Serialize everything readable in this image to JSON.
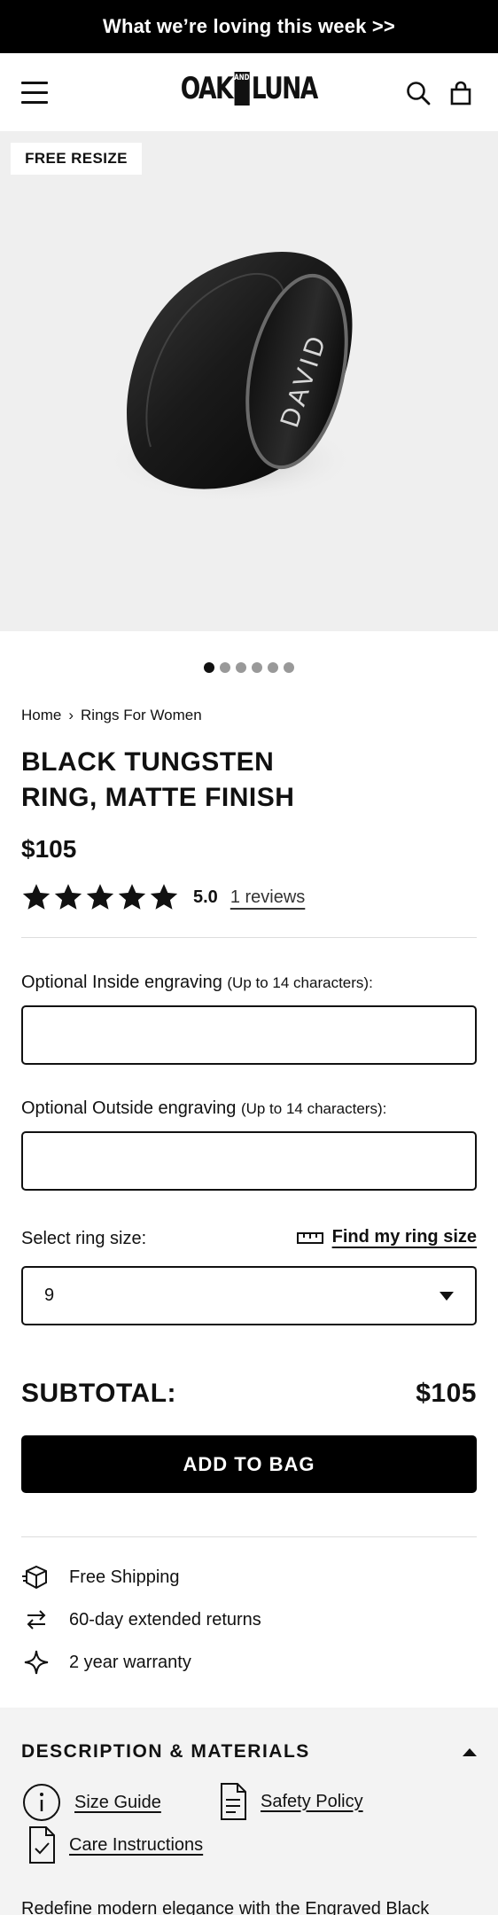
{
  "announcement": "What we’re loving this week >>",
  "header": {
    "logo_left": "OAK",
    "logo_amp": "AND",
    "logo_right": "LUNA"
  },
  "gallery": {
    "badge": "FREE RESIZE",
    "engraving_shown": "DAVID",
    "slide_count": 6,
    "active_slide": 1
  },
  "breadcrumb": {
    "home": "Home",
    "separator": "›",
    "current": "Rings For Women"
  },
  "product": {
    "title_line1": "BLACK TUNGSTEN",
    "title_line2": "RING, MATTE FINISH",
    "price": "$105",
    "rating": "5.0",
    "reviews_label": "1 reviews",
    "star_count": 5
  },
  "form": {
    "inside_label": "Optional Inside engraving",
    "inside_hint": "(Up to 14 characters):",
    "inside_value": "",
    "outside_label": "Optional Outside engraving",
    "outside_hint": "(Up to 14 characters):",
    "outside_value": "",
    "size_label": "Select ring size:",
    "find_size_label": "Find my ring size",
    "size_value": "9"
  },
  "cart": {
    "subtotal_label": "SUBTOTAL:",
    "subtotal_value": "$105",
    "add_button": "ADD TO BAG"
  },
  "perks": [
    {
      "icon": "package-icon",
      "label": "Free Shipping"
    },
    {
      "icon": "arrows-exchange-icon",
      "label": "60-day extended returns"
    },
    {
      "icon": "sparkle-icon",
      "label": "2 year warranty"
    }
  ],
  "description": {
    "title": "DESCRIPTION & MATERIALS",
    "size_guide": "Size Guide",
    "safety_policy": "Safety Policy",
    "care_instructions": "Care Instructions",
    "body": "Redefine modern elegance with the Engraved Black"
  }
}
